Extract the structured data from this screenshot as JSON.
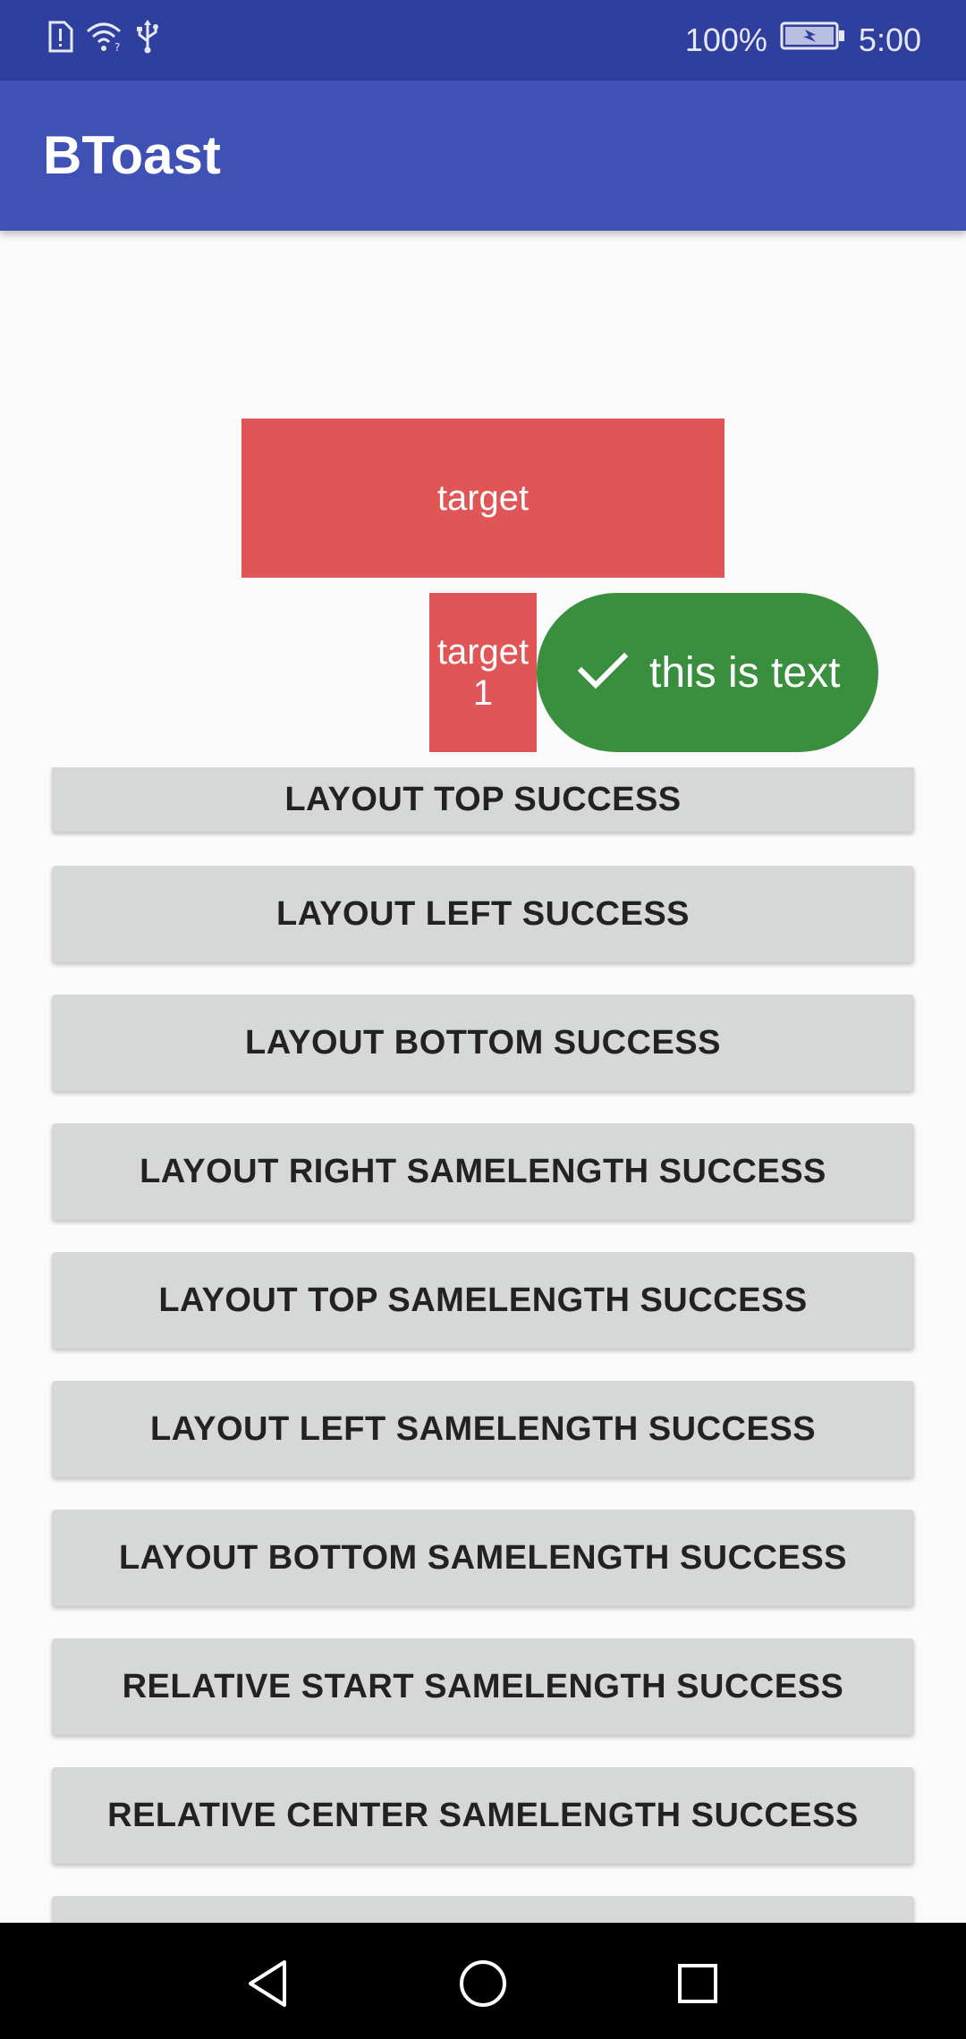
{
  "status_bar": {
    "battery_percent": "100%",
    "time": "5:00",
    "icons": [
      "alert-sim-icon",
      "wifi-question-icon",
      "usb-icon",
      "battery-charging-icon"
    ]
  },
  "app_bar": {
    "title": "BToast"
  },
  "targets": {
    "main_label": "target",
    "small_label_line1": "target",
    "small_label_line2": "1"
  },
  "toast": {
    "icon": "check-icon",
    "text": "this is text",
    "color": "#3a8f3e"
  },
  "buttons": [
    {
      "label": "LAYOUT TOP SUCCESS"
    },
    {
      "label": "LAYOUT LEFT SUCCESS"
    },
    {
      "label": "LAYOUT BOTTOM SUCCESS"
    },
    {
      "label": "LAYOUT RIGHT SAMELENGTH SUCCESS"
    },
    {
      "label": "LAYOUT TOP SAMELENGTH SUCCESS"
    },
    {
      "label": "LAYOUT LEFT SAMELENGTH SUCCESS"
    },
    {
      "label": "LAYOUT BOTTOM SAMELENGTH SUCCESS"
    },
    {
      "label": "RELATIVE START SAMELENGTH SUCCESS"
    },
    {
      "label": "RELATIVE CENTER SAMELENGTH SUCCESS"
    },
    {
      "label": ""
    }
  ],
  "colors": {
    "status_bar": "#2f3f9e",
    "app_bar": "#3f51b5",
    "target": "#e05656",
    "button_bg": "#d6d7d7"
  },
  "nav_bar": {
    "icons": [
      "back-icon",
      "home-icon",
      "recents-icon"
    ]
  }
}
